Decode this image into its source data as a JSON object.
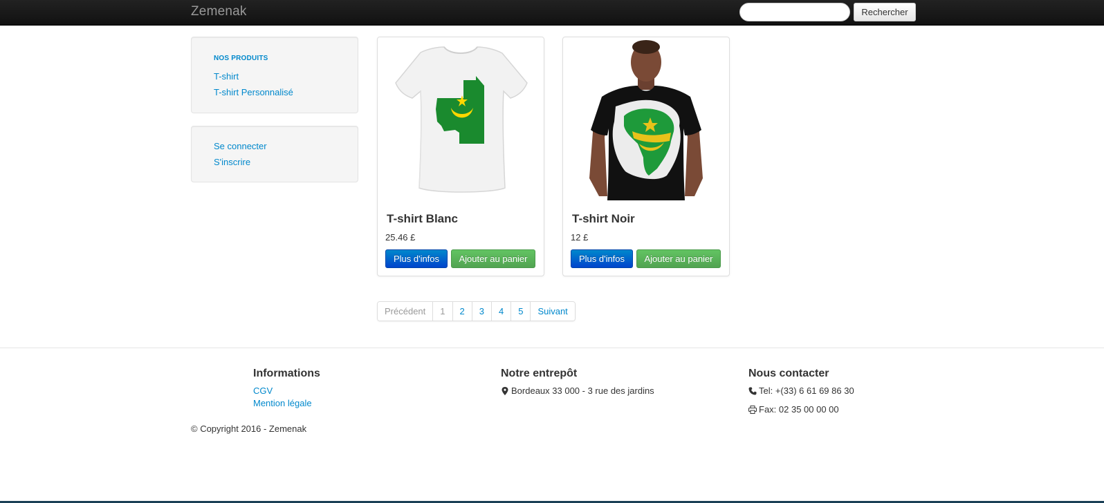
{
  "navbar": {
    "brand": "Zemenak",
    "search_placeholder": "",
    "search_button": "Rechercher"
  },
  "sidebar": {
    "products_header": "NOS PRODUITS",
    "product_links": [
      "T-shirt",
      "T-shirt Personnalisé"
    ],
    "account_links": [
      "Se connecter",
      "S'inscrire"
    ]
  },
  "products": [
    {
      "title": "T-shirt Blanc",
      "price": "25.46 £",
      "info_button": "Plus d'infos",
      "cart_button": "Ajouter au panier",
      "image": "white-tshirt-mauritania-map"
    },
    {
      "title": "T-shirt Noir",
      "price": "12 £",
      "info_button": "Plus d'infos",
      "cart_button": "Ajouter au panier",
      "image": "model-black-tshirt-africa-map"
    }
  ],
  "pagination": {
    "previous": "Précédent",
    "pages": [
      "1",
      "2",
      "3",
      "4",
      "5"
    ],
    "next": "Suivant"
  },
  "footer": {
    "informations": {
      "heading": "Informations",
      "links": [
        "CGV",
        "Mention légale"
      ]
    },
    "warehouse": {
      "heading": "Notre entrepôt",
      "address": "Bordeaux 33 000 - 3 rue des jardins"
    },
    "contact": {
      "heading": "Nous contacter",
      "tel": "Tel: +(33) 6 61 69 86 30",
      "fax": "Fax: 02 35 00 00 00"
    },
    "copyright": "© Copyright 2016 - Zemenak"
  },
  "colors": {
    "link": "#0088cc",
    "primary": "#0044cc",
    "success": "#51a351",
    "navbar": "#111111"
  }
}
